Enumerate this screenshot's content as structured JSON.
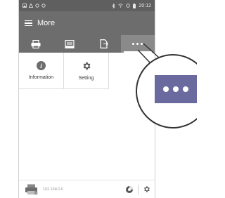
{
  "status_bar": {
    "time": "20:12"
  },
  "header": {
    "title": "More"
  },
  "toolbar": {
    "items": [
      {
        "icon": "printer-icon"
      },
      {
        "icon": "scanner-icon"
      },
      {
        "icon": "document-send-icon"
      },
      {
        "icon": "more-dots-icon",
        "active": true
      }
    ]
  },
  "grid": {
    "items": [
      {
        "label": "Information",
        "icon": "info-icon"
      },
      {
        "label": "Setting",
        "icon": "gear-icon"
      }
    ]
  },
  "bottom_bar": {
    "device_ip": "192.168.0.6"
  },
  "colors": {
    "header_bg": "#6d6d6d",
    "status_bg": "#5f5f5f",
    "callout_button": "#6a6a9e"
  }
}
